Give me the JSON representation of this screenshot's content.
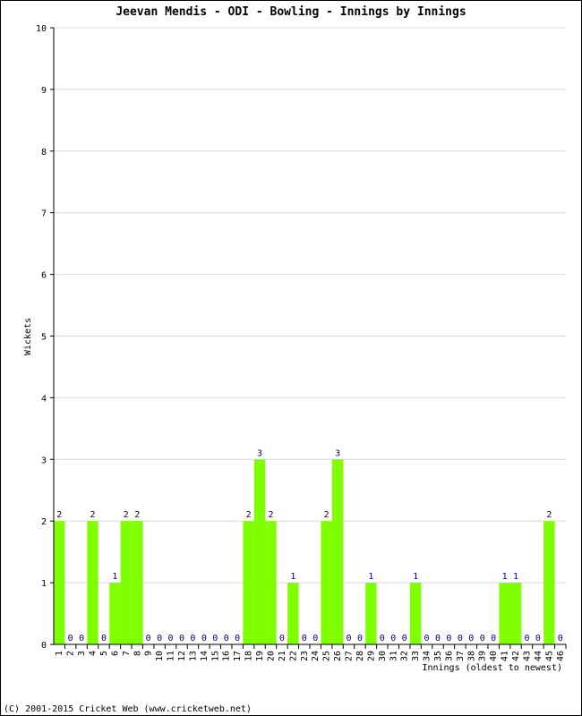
{
  "chart_data": {
    "type": "bar",
    "title": "Jeevan Mendis - ODI - Bowling - Innings by Innings",
    "xlabel": "Innings (oldest to newest)",
    "ylabel": "Wickets",
    "ylim": [
      0,
      10
    ],
    "yticks": [
      "0",
      "1",
      "2",
      "3",
      "4",
      "5",
      "6",
      "7",
      "8",
      "9",
      "10"
    ],
    "grid": true,
    "categories": [
      "1",
      "2",
      "3",
      "4",
      "5",
      "6",
      "7",
      "8",
      "9",
      "10",
      "11",
      "12",
      "13",
      "14",
      "15",
      "16",
      "17",
      "18",
      "19",
      "20",
      "21",
      "22",
      "23",
      "24",
      "25",
      "26",
      "27",
      "28",
      "29",
      "30",
      "31",
      "32",
      "33",
      "34",
      "35",
      "36",
      "37",
      "38",
      "39",
      "40",
      "41",
      "42",
      "43",
      "44",
      "45",
      "46"
    ],
    "values": [
      2,
      0,
      0,
      2,
      0,
      1,
      2,
      2,
      0,
      0,
      0,
      0,
      0,
      0,
      0,
      0,
      0,
      2,
      3,
      2,
      0,
      1,
      0,
      0,
      2,
      3,
      0,
      0,
      1,
      0,
      0,
      0,
      1,
      0,
      0,
      0,
      0,
      0,
      0,
      0,
      1,
      1,
      0,
      0,
      2,
      0
    ],
    "bar_color": "#80ff00",
    "label_color": "#000080",
    "grid_color": "#d8d8d8"
  },
  "footer": "(C) 2001-2015 Cricket Web (www.cricketweb.net)"
}
